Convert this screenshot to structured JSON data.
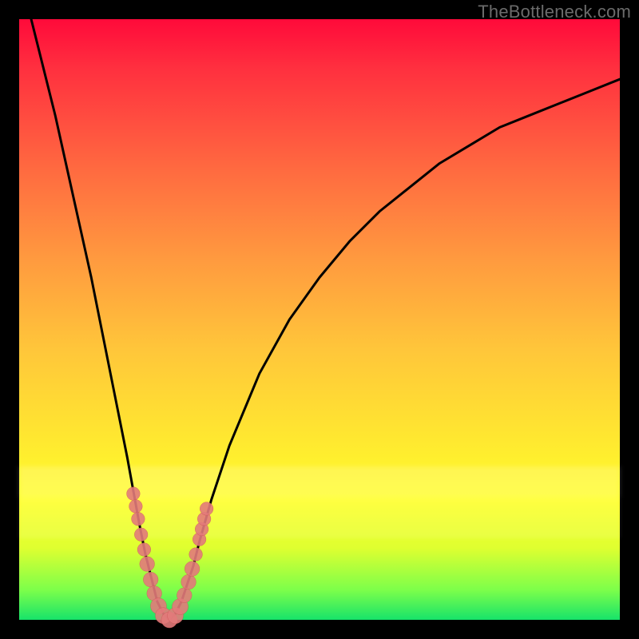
{
  "watermark": "TheBottleneck.com",
  "colors": {
    "curve": "#000000",
    "marker_fill": "#e37b7b",
    "marker_stroke": "#cf5a5a",
    "gradient_top": "#ff0a3a",
    "gradient_bottom": "#17e36a",
    "frame": "#000000"
  },
  "chart_data": {
    "type": "line",
    "title": "",
    "xlabel": "",
    "ylabel": "",
    "xlim": [
      0,
      100
    ],
    "ylim": [
      0,
      100
    ],
    "x_min_at": 25,
    "curve": {
      "x": [
        2,
        4,
        6,
        8,
        10,
        12,
        14,
        16,
        18,
        20,
        21,
        22,
        23,
        24,
        25,
        26,
        27,
        28,
        29,
        30,
        32,
        35,
        40,
        45,
        50,
        55,
        60,
        65,
        70,
        75,
        80,
        85,
        90,
        95,
        100
      ],
      "y": [
        100,
        92,
        84,
        75,
        66,
        57,
        47,
        37,
        27,
        16,
        11,
        7,
        3,
        1,
        0,
        1,
        3,
        6,
        9,
        13,
        20,
        29,
        41,
        50,
        57,
        63,
        68,
        72,
        76,
        79,
        82,
        84,
        86,
        88,
        90
      ]
    },
    "markers": {
      "x": [
        19.0,
        19.4,
        19.8,
        20.3,
        20.8,
        21.3,
        21.9,
        22.5,
        23.2,
        24.0,
        25.0,
        26.0,
        26.8,
        27.5,
        28.2,
        28.8,
        29.4,
        30.0,
        30.4,
        30.8,
        31.2
      ],
      "y": [
        21.0,
        18.9,
        16.8,
        14.2,
        11.7,
        9.3,
        6.7,
        4.4,
        2.3,
        0.7,
        0.0,
        0.7,
        2.2,
        4.1,
        6.3,
        8.5,
        10.9,
        13.4,
        15.1,
        16.8,
        18.5
      ]
    }
  }
}
